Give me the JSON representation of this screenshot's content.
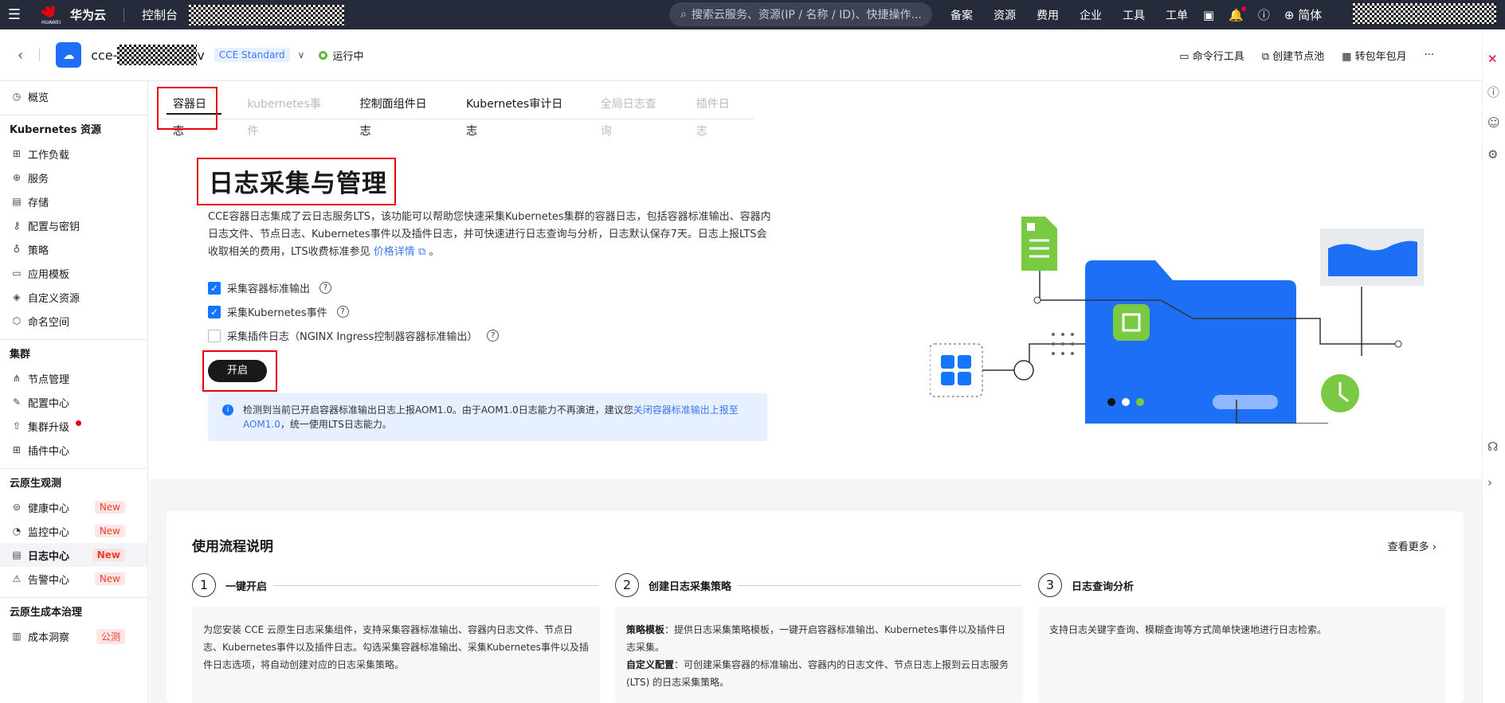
{
  "topbar": {
    "menu_icon": "hamburger-icon",
    "brand_small": "HUAWEI",
    "brand_name": "华为云",
    "console": "控制台",
    "search_placeholder": "搜索云服务、资源(IP / 名称 / ID)、快捷操作...",
    "nav": [
      "备案",
      "资源",
      "费用",
      "企业",
      "工具",
      "工单"
    ],
    "language": "简体"
  },
  "cluster": {
    "name_prefix": "cce-",
    "name_suffix": "v",
    "badge": "CCE Standard",
    "status": "运行中",
    "actions": [
      "命令行工具",
      "创建节点池",
      "转包年包月"
    ],
    "more": "···"
  },
  "sidebar": {
    "overview": "概览",
    "sections": [
      {
        "title": "Kubernetes 资源",
        "items": [
          "工作负载",
          "服务",
          "存储",
          "配置与密钥",
          "策略",
          "应用模板",
          "自定义资源",
          "命名空间"
        ]
      },
      {
        "title": "集群",
        "items": [
          "节点管理",
          "配置中心",
          "集群升级",
          "插件中心"
        ]
      },
      {
        "title": "云原生观测",
        "items": [
          "健康中心",
          "监控中心",
          "日志中心",
          "告警中心"
        ],
        "badges": [
          "New",
          "New",
          "New",
          "New"
        ]
      },
      {
        "title": "云原生成本治理",
        "items": [
          "成本洞察"
        ],
        "badges": [
          "公测"
        ]
      }
    ]
  },
  "tabs": [
    "容器日志",
    "kubernetes事件",
    "控制面组件日志",
    "Kubernetes审计日志",
    "全局日志查询",
    "插件日志"
  ],
  "hero": {
    "title": "日志采集与管理",
    "desc": "CCE容器日志集成了云日志服务LTS，该功能可以帮助您快速采集Kubernetes集群的容器日志，包括容器标准输出、容器内日志文件、节点日志、Kubernetes事件以及插件日志，并可快速进行日志查询与分析，日志默认保存7天。日志上报LTS会收取相关的费用，LTS收费标准参见",
    "link": "价格详情",
    "desc_end": "。",
    "checkboxes": [
      {
        "label": "采集容器标准输出",
        "checked": true
      },
      {
        "label": "采集Kubernetes事件",
        "checked": true
      },
      {
        "label": "采集插件日志（NGINX Ingress控制器容器标准输出）",
        "checked": false
      }
    ],
    "start": "开启",
    "info_text": "检测到当前已开启容器标准输出日志上报AOM1.0。由于AOM1.0日志能力不再演进，建议您",
    "info_link": "关闭容器标准输出上报至AOM1.0",
    "info_end": "，统一使用LTS日志能力。"
  },
  "flow": {
    "title": "使用流程说明",
    "more": "查看更多",
    "steps": [
      {
        "num": "1",
        "title": "一键开启",
        "text": "为您安装 CCE 云原生日志采集组件，支持采集容器标准输出、容器内日志文件、节点日志、Kubernetes事件以及插件日志。勾选采集容器标准输出、采集Kubernetes事件以及插件日志选项，将自动创建对应的日志采集策略。"
      },
      {
        "num": "2",
        "title": "创建日志采集策略",
        "k1": "策略模板",
        "t1": "：提供日志采集策略模板，一键开启容器标准输出、Kubernetes事件以及插件日志采集。",
        "k2": "自定义配置",
        "t2": "：可创建采集容器的标准输出、容器内的日志文件、节点日志上报到云日志服务(LTS) 的日志采集策略。"
      },
      {
        "num": "3",
        "title": "日志查询分析",
        "text": "支持日志关键字查询、模糊查询等方式简单快速地进行日志检索。"
      }
    ]
  },
  "colors": {
    "topbar": "#252b3a",
    "accent": "#1476ff",
    "highlight": "#e60012",
    "green": "#7ac943"
  }
}
